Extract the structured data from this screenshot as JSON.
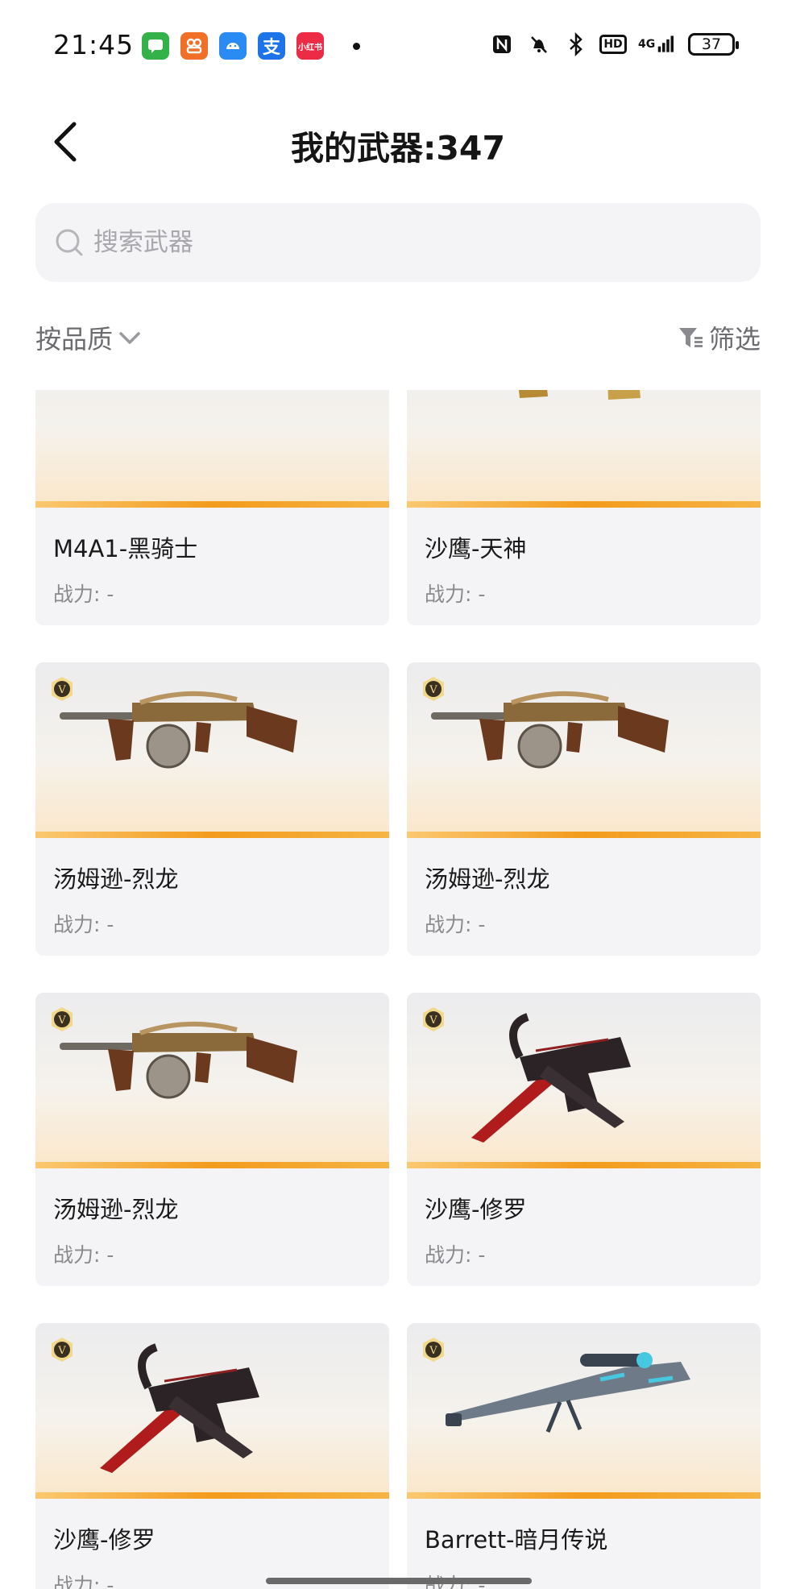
{
  "status_bar": {
    "time": "21:45",
    "apps": [
      {
        "icon": "messages-icon",
        "color": "#34b24a",
        "glyph": "✉"
      },
      {
        "icon": "taobao-icon",
        "color": "#f07028",
        "glyph": "淘"
      },
      {
        "icon": "android-icon",
        "color": "#2a8bf2",
        "glyph": "◉"
      },
      {
        "icon": "alipay-icon",
        "color": "#1d73e8",
        "glyph": "支"
      },
      {
        "icon": "xiaohongshu-icon",
        "color": "#ec2b45",
        "glyph": "小红书"
      }
    ],
    "hd_label": "HD",
    "network_label": "4G",
    "battery": "37"
  },
  "header": {
    "title": "我的武器:347"
  },
  "search": {
    "placeholder": "搜索武器",
    "value": ""
  },
  "toolbar": {
    "sort_label": "按品质",
    "filter_label": "筛选"
  },
  "weapons": [
    {
      "name": "M4A1-黑骑士",
      "power": "战力: -",
      "badge": false,
      "art": "rifle-dark"
    },
    {
      "name": "沙鹰-天神",
      "power": "战力: -",
      "badge": false,
      "art": "pistol-gold"
    },
    {
      "name": "汤姆逊-烈龙",
      "power": "战力: -",
      "badge": true,
      "art": "tommy"
    },
    {
      "name": "汤姆逊-烈龙",
      "power": "战力: -",
      "badge": true,
      "art": "tommy"
    },
    {
      "name": "汤姆逊-烈龙",
      "power": "战力: -",
      "badge": true,
      "art": "tommy"
    },
    {
      "name": "沙鹰-修罗",
      "power": "战力: -",
      "badge": true,
      "art": "deagle-blade"
    },
    {
      "name": "沙鹰-修罗",
      "power": "战力: -",
      "badge": true,
      "art": "deagle-blade"
    },
    {
      "name": "Barrett-暗月传说",
      "power": "战力: -",
      "badge": true,
      "art": "sniper"
    }
  ],
  "colors": {
    "accent_orange": "#f39b1c",
    "card_bg": "#f4f4f6",
    "muted_text": "#8a8a8e"
  }
}
